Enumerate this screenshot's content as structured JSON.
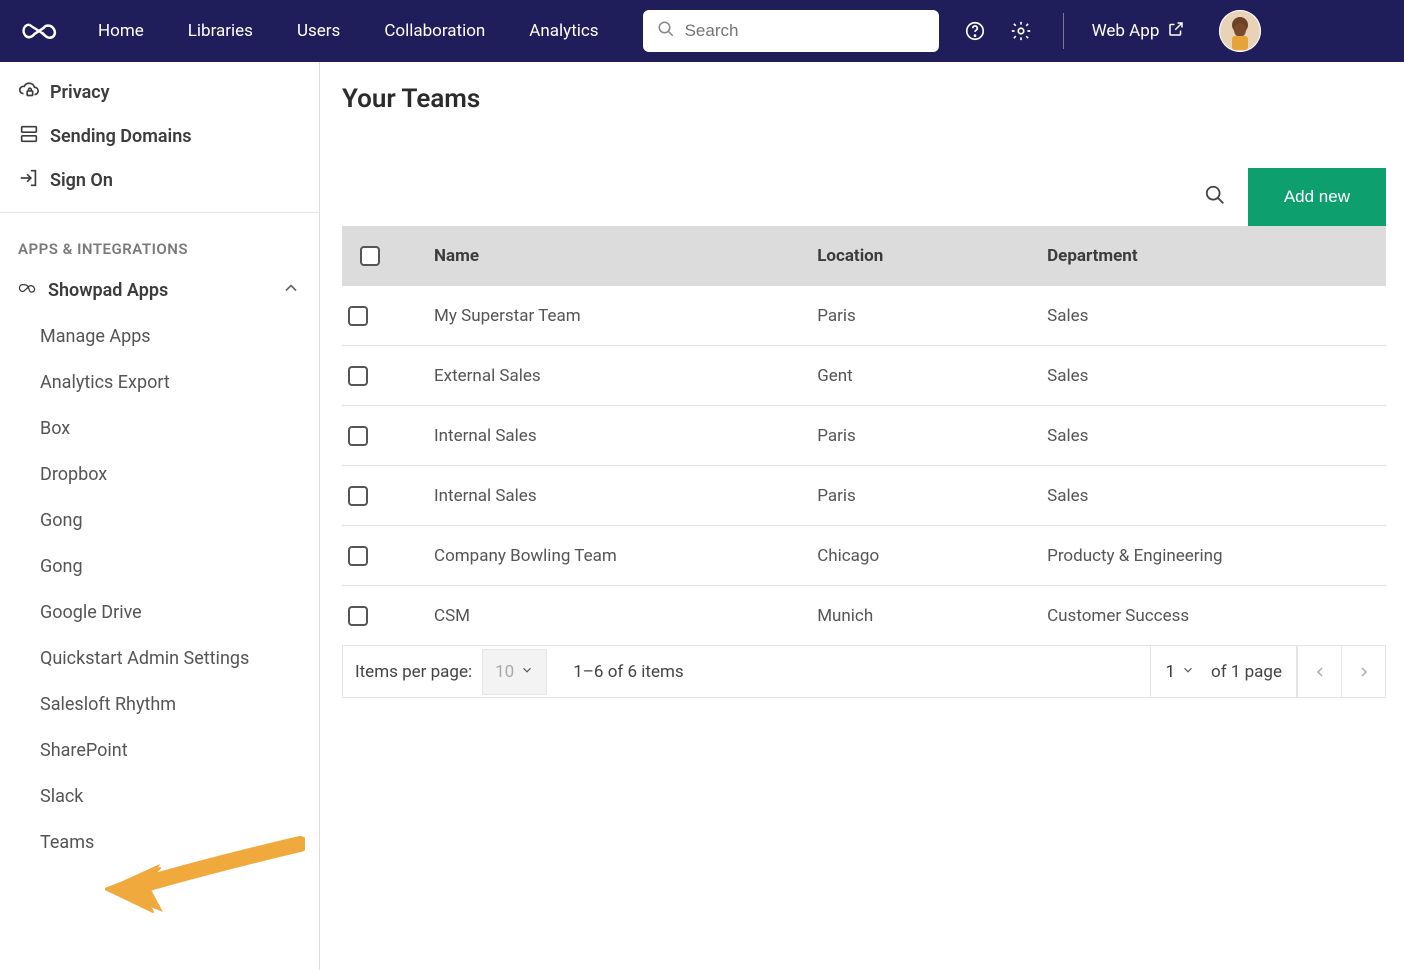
{
  "nav": {
    "links": [
      "Home",
      "Libraries",
      "Users",
      "Collaboration",
      "Analytics"
    ],
    "search_placeholder": "Search",
    "web_app": "Web App"
  },
  "sidebar": {
    "top": [
      {
        "label": "Privacy",
        "icon": "cloud-lock-icon"
      },
      {
        "label": "Sending Domains",
        "icon": "server-icon"
      },
      {
        "label": "Sign On",
        "icon": "signin-icon"
      }
    ],
    "heading": "APPS & INTEGRATIONS",
    "group": {
      "label": "Showpad Apps"
    },
    "subs": [
      "Manage Apps",
      "Analytics Export",
      "Box",
      "Dropbox",
      "Gong",
      "Gong",
      "Google Drive",
      "Quickstart Admin Settings",
      "Salesloft Rhythm",
      "SharePoint",
      "Slack",
      "Teams"
    ]
  },
  "main": {
    "title": "Your Teams",
    "add_label": "Add new",
    "columns": [
      "Name",
      "Location",
      "Department"
    ],
    "rows": [
      {
        "name": "My Superstar Team",
        "location": "Paris",
        "department": "Sales"
      },
      {
        "name": "External Sales",
        "location": "Gent",
        "department": "Sales"
      },
      {
        "name": "Internal Sales",
        "location": "Paris",
        "department": "Sales"
      },
      {
        "name": "Internal Sales",
        "location": "Paris",
        "department": "Sales"
      },
      {
        "name": "Company Bowling Team",
        "location": "Chicago",
        "department": "Producty & Engineering"
      },
      {
        "name": "CSM",
        "location": "Munich",
        "department": "Customer Success"
      }
    ],
    "pager": {
      "per_label": "Items per page:",
      "per_value": "10",
      "range": "1–6 of 6 items",
      "page_value": "1",
      "of_label": "of 1 page"
    }
  }
}
